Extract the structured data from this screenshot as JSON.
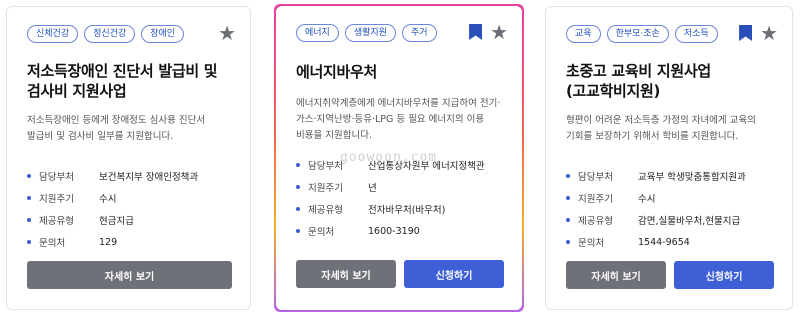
{
  "cards": [
    {
      "tags": [
        "신체건강",
        "정신건강",
        "장애인"
      ],
      "show_bookmark": false,
      "title": "저소득장애인 진단서 발급비 및 검사비 지원사업",
      "description": "저소득장애인 등에게 장애정도 심사용 진단서 발급비 및 검사비 일부를 지원합니다.",
      "info": [
        {
          "label": "담당부처",
          "value": "보건복지부 장애인정책과"
        },
        {
          "label": "지원주기",
          "value": "수시"
        },
        {
          "label": "제공유형",
          "value": "현금지급"
        },
        {
          "label": "문의처",
          "value": "129"
        }
      ],
      "buttons": {
        "detail": "자세히 보기"
      }
    },
    {
      "tags": [
        "에너지",
        "생활지원",
        "주거"
      ],
      "show_bookmark": true,
      "title": "에너지바우처",
      "description": "에너지취약계층에게 에너지바우처를 지급하여 전기·가스·지역난방·등유·LPG 등 필요 에너지의 이용 비용을 지원합니다.",
      "info": [
        {
          "label": "담당부처",
          "value": "산업통상자원부 에너지정책관"
        },
        {
          "label": "지원주기",
          "value": "년"
        },
        {
          "label": "제공유형",
          "value": "전자바우처(바우처)"
        },
        {
          "label": "문의처",
          "value": "1600-3190"
        }
      ],
      "buttons": {
        "detail": "자세히 보기",
        "apply": "신청하기"
      }
    },
    {
      "tags": [
        "교육",
        "한부모·조손",
        "저소득"
      ],
      "show_bookmark": true,
      "title": "초중고 교육비 지원사업(고교학비지원)",
      "description": "형편이 어려운 저소득층 가정의 자녀에게 교육의 기회를 보장하기 위해서 학비를 지원합니다.",
      "info": [
        {
          "label": "담당부처",
          "value": "교육부 학생맞춤통합지원과"
        },
        {
          "label": "지원주기",
          "value": "수시"
        },
        {
          "label": "제공유형",
          "value": "감면,실물바우처,현물지급"
        },
        {
          "label": "문의처",
          "value": "1544-9654"
        }
      ],
      "buttons": {
        "detail": "자세히 보기",
        "apply": "신청하기"
      }
    }
  ],
  "watermark": "goowoon.com"
}
